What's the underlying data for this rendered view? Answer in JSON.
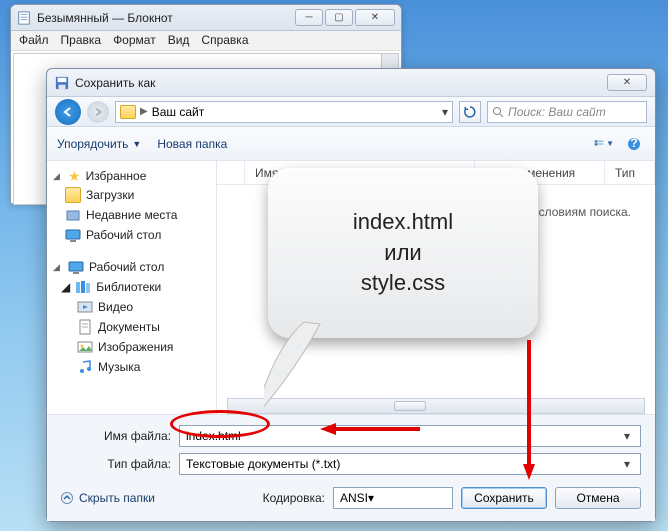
{
  "notepad": {
    "title": "Безымянный — Блокнот",
    "menu": [
      "Файл",
      "Правка",
      "Формат",
      "Вид",
      "Справка"
    ]
  },
  "dialog": {
    "title": "Сохранить как",
    "path_label": "Ваш сайт",
    "search_placeholder": "Поиск: Ваш сайт",
    "toolbar": {
      "organize": "Упорядочить",
      "new_folder": "Новая папка"
    },
    "tree": {
      "favorites_label": "Избранное",
      "favorites": [
        "Загрузки",
        "Недавние места",
        "Рабочий стол"
      ],
      "desktop_label": "Рабочий стол",
      "libraries_label": "Библиотеки",
      "libraries": [
        "Видео",
        "Документы",
        "Изображения",
        "Музыка"
      ]
    },
    "columns": {
      "name": "Имя",
      "date": "Дата изменения",
      "type": "Тип"
    },
    "empty_msg_tail": "словиям поиска.",
    "filename_label": "Имя файла:",
    "filename_value": "index.html",
    "filetype_label": "Тип файла:",
    "filetype_value": "Текстовые документы (*.txt)",
    "hide_folders": "Скрыть папки",
    "encoding_label": "Кодировка:",
    "encoding_value": "ANSI",
    "save_btn": "Сохранить",
    "cancel_btn": "Отмена"
  },
  "annotation": {
    "line1": "index.html",
    "line2": "или",
    "line3": "style.css"
  }
}
